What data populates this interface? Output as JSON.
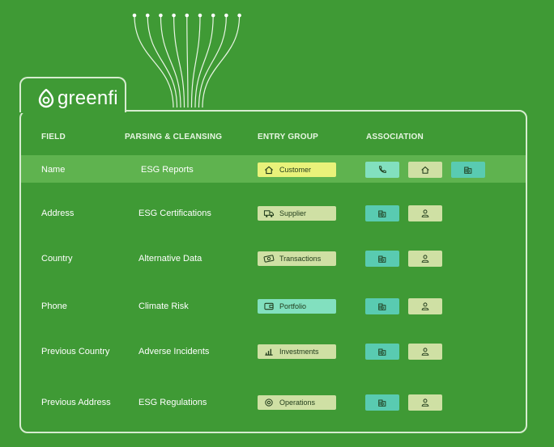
{
  "brand": {
    "name": "greenfi"
  },
  "colors": {
    "background": "#3f9a35",
    "row_highlight": "#5fb34f",
    "yellow": "#e9f27a",
    "khaki": "#cfe0a4",
    "mint": "#82e0bf",
    "teal": "#59cbb1"
  },
  "headers": {
    "field": "FIELD",
    "parsing": "PARSING & CLEANSING",
    "entry": "ENTRY GROUP",
    "association": "ASSOCIATION"
  },
  "rows": [
    {
      "field": "Name",
      "parsing": "ESG Reports",
      "entry": "Customer",
      "entry_icon": "home-icon",
      "assoc": [
        "phone-icon",
        "home-icon",
        "building-icon"
      ]
    },
    {
      "field": "Address",
      "parsing": "ESG Certifications",
      "entry": "Supplier",
      "entry_icon": "truck-icon",
      "assoc": [
        "building-icon",
        "person-icon"
      ]
    },
    {
      "field": "Country",
      "parsing": "Alternative Data",
      "entry": "Transactions",
      "entry_icon": "money-icon",
      "assoc": [
        "building-icon",
        "person-icon"
      ]
    },
    {
      "field": "Phone",
      "parsing": "Climate Risk",
      "entry": "Portfolio",
      "entry_icon": "wallet-icon",
      "assoc": [
        "building-icon",
        "person-icon"
      ]
    },
    {
      "field": "Previous Country",
      "parsing": "Adverse Incidents",
      "entry": "Investments",
      "entry_icon": "chart-icon",
      "assoc": [
        "building-icon",
        "person-icon"
      ]
    },
    {
      "field": "Previous Address",
      "parsing": "ESG Regulations",
      "entry": "Operations",
      "entry_icon": "gear-icon",
      "assoc": [
        "building-icon",
        "person-icon"
      ]
    }
  ]
}
